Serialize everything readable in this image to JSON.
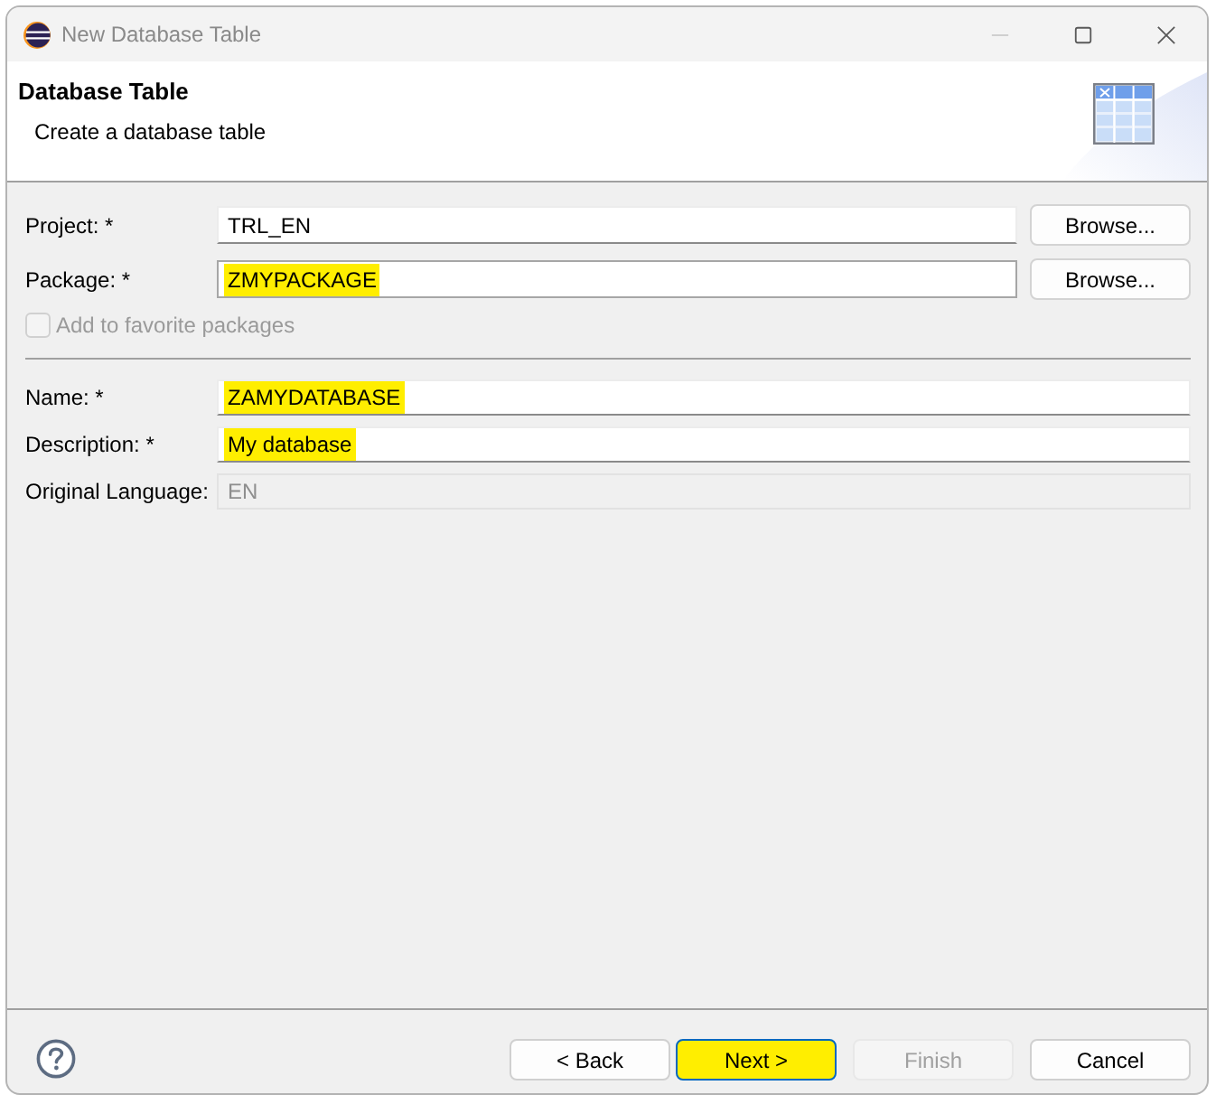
{
  "window": {
    "title": "New Database Table",
    "controls": [
      {
        "kind": "minimize",
        "disabled": true
      },
      {
        "kind": "maximize",
        "disabled": false
      },
      {
        "kind": "close",
        "disabled": false
      }
    ]
  },
  "header": {
    "title": "Database Table",
    "subtitle": "Create a database table"
  },
  "package_fields": [
    {
      "label": "Project: *",
      "value": "TRL_EN",
      "focused": false,
      "highlighted": false,
      "button": "Browse..."
    },
    {
      "label": "Package: *",
      "value": "ZMYPACKAGE",
      "focused": true,
      "highlighted": true,
      "button": "Browse..."
    }
  ],
  "favorite_checkbox": {
    "label": "Add to favorite packages",
    "checked": false,
    "disabled": true
  },
  "object_fields": [
    {
      "label": "Name: *",
      "value": "ZAMYDATABASE",
      "disabled": false,
      "highlighted": true
    },
    {
      "label": "Description: *",
      "value": "My database",
      "disabled": false,
      "highlighted": true
    },
    {
      "label": "Original Language:",
      "value": "EN",
      "disabled": true,
      "highlighted": false
    }
  ],
  "footer_buttons": [
    {
      "label": "< Back",
      "disabled": false,
      "default": false,
      "highlighted": false
    },
    {
      "label": "Next >",
      "disabled": false,
      "default": true,
      "highlighted": true
    },
    {
      "label": "Finish",
      "disabled": true,
      "default": false,
      "highlighted": false
    },
    {
      "label": "Cancel",
      "disabled": false,
      "default": false,
      "highlighted": false
    }
  ]
}
